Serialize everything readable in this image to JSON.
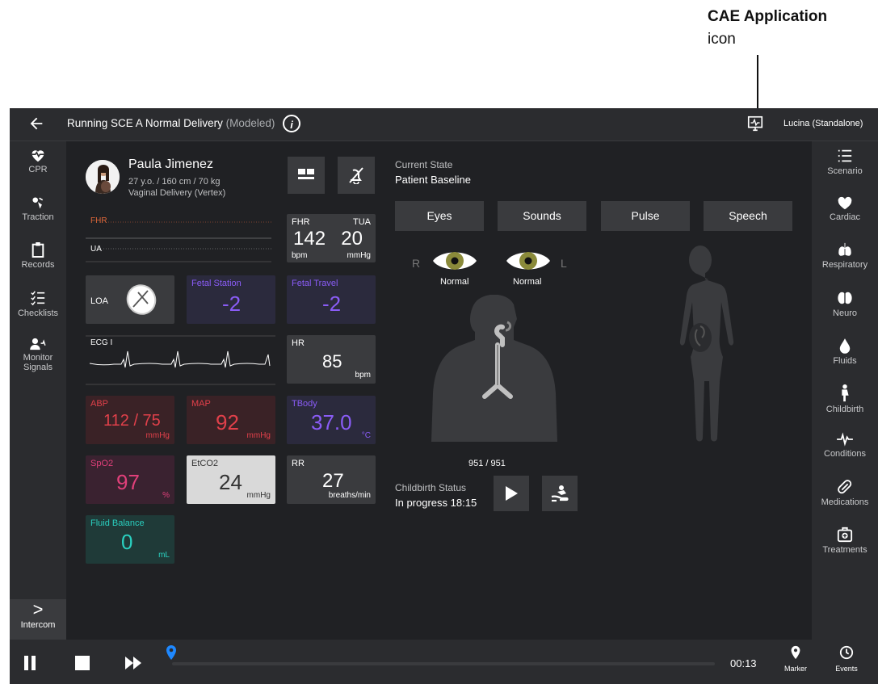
{
  "callout": {
    "title": "CAE Application",
    "subtitle": "icon"
  },
  "topbar": {
    "title_main": "Running SCE  A Normal Delivery",
    "title_mode": "(Modeled)",
    "info_glyph": "i",
    "user": "Lucina (Standalone)"
  },
  "leftnav": [
    {
      "label": "CPR",
      "icon": "heart-pulse-icon"
    },
    {
      "label": "Traction",
      "icon": "traction-icon"
    },
    {
      "label": "Records",
      "icon": "clipboard-icon"
    },
    {
      "label": "Checklists",
      "icon": "checklist-icon"
    },
    {
      "label": "Monitor Signals",
      "icon": "monitor-signals-icon"
    }
  ],
  "intercom": {
    "label": "Intercom",
    "glyph": ">"
  },
  "rightnav": [
    {
      "label": "Scenario",
      "icon": "list-icon"
    },
    {
      "label": "Cardiac",
      "icon": "heart-icon"
    },
    {
      "label": "Respiratory",
      "icon": "lungs-icon"
    },
    {
      "label": "Neuro",
      "icon": "brain-icon"
    },
    {
      "label": "Fluids",
      "icon": "drop-icon"
    },
    {
      "label": "Childbirth",
      "icon": "childbirth-icon"
    },
    {
      "label": "Conditions",
      "icon": "pulse-icon"
    },
    {
      "label": "Medications",
      "icon": "pill-icon"
    },
    {
      "label": "Treatments",
      "icon": "first-aid-icon"
    }
  ],
  "patient": {
    "name": "Paula Jimenez",
    "details": "27 y.o. / 160 cm / 70 kg",
    "delivery": "Vaginal Delivery (Vertex)"
  },
  "waves": {
    "fhr": "FHR",
    "ua": "UA",
    "ecg": "ECG I"
  },
  "vitals": {
    "fhr": {
      "label": "FHR",
      "value": "142",
      "unit": "bpm"
    },
    "tua": {
      "label": "TUA",
      "value": "20",
      "unit": "mmHg"
    },
    "loa": {
      "label": "LOA"
    },
    "fetal_station": {
      "label": "Fetal Station",
      "value": "-2"
    },
    "fetal_travel": {
      "label": "Fetal Travel",
      "value": "-2"
    },
    "hr": {
      "label": "HR",
      "value": "85",
      "unit": "bpm"
    },
    "abp": {
      "label": "ABP",
      "value": "112 / 75",
      "unit": "mmHg"
    },
    "map": {
      "label": "MAP",
      "value": "92",
      "unit": "mmHg"
    },
    "tbody": {
      "label": "TBody",
      "value": "37.0",
      "unit": "°C"
    },
    "spo2": {
      "label": "SpO2",
      "value": "97",
      "unit": "%"
    },
    "etco2": {
      "label": "EtCO2",
      "value": "24",
      "unit": "mmHg"
    },
    "rr": {
      "label": "RR",
      "value": "27",
      "unit": "breaths/min"
    },
    "fluid": {
      "label": "Fluid Balance",
      "value": "0",
      "unit": "mL"
    }
  },
  "state": {
    "heading": "Current State",
    "value": "Patient Baseline"
  },
  "tabs": [
    "Eyes",
    "Sounds",
    "Pulse",
    "Speech"
  ],
  "eyes": {
    "right_letter": "R",
    "left_letter": "L",
    "right_status": "Normal",
    "left_status": "Normal"
  },
  "airway_count": "951 / 951",
  "childbirth": {
    "heading": "Childbirth Status",
    "value": "In progress 18:15"
  },
  "playback": {
    "time": "00:13",
    "marker": "Marker",
    "events": "Events",
    "progress": 0.0
  },
  "colors": {
    "fhr": "#e0683a",
    "violet": "#8a5cf6",
    "red": "#e0404a",
    "pink": "#e0407a",
    "teal": "#2ad0c0",
    "tile": "#3a3b3e"
  }
}
